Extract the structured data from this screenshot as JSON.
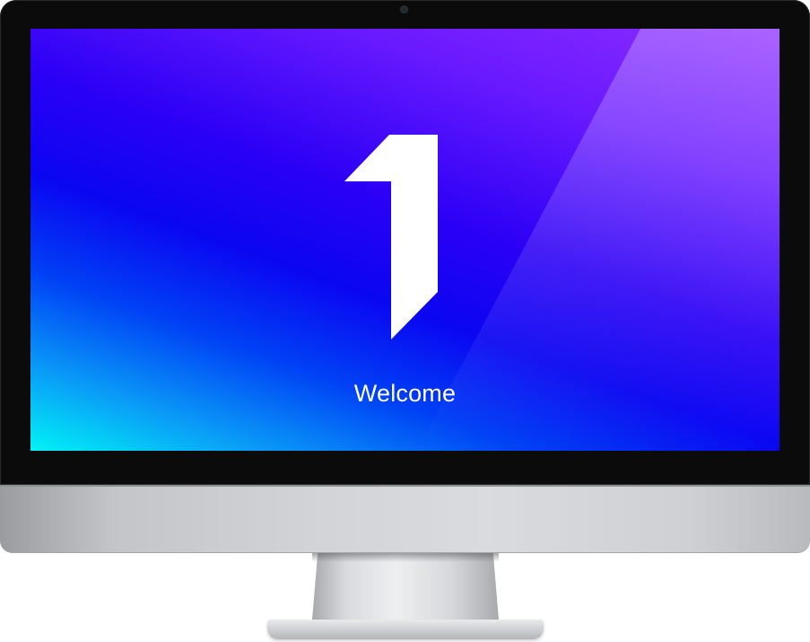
{
  "screen": {
    "welcome_text": "Welcome",
    "logo_icon": "1password-logo-icon",
    "gradient_colors": [
      "#8d2cff",
      "#2b00f5",
      "#0041f5",
      "#00f3f6"
    ]
  },
  "device": {
    "type": "desktop-monitor",
    "bezel_color": "#0b0b0b",
    "body_color": "#d3d4d7"
  }
}
